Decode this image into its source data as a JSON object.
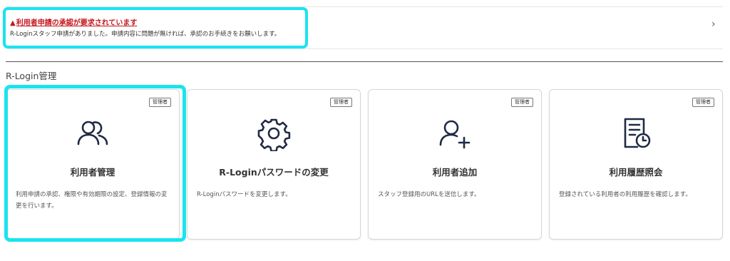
{
  "notice": {
    "warning_glyph": "▲",
    "title": "利用者申請の承認が要求されています",
    "description": "R-Loginスタッフ申請がありました。申請内容に問題が無ければ、承認のお手続きをお願いします。",
    "chevron": "›",
    "title_color": "#c4161c"
  },
  "section": {
    "title": "R-Login管理"
  },
  "cards": [
    {
      "badge": "管理者",
      "icon": "users-icon",
      "title": "利用者管理",
      "description": "利用申請の承認、権限や有効期限の設定、登録情報の変更を行います。"
    },
    {
      "badge": "管理者",
      "icon": "gear-icon",
      "title": "R-Loginパスワードの変更",
      "description": "R-Loginパスワードを変更します。"
    },
    {
      "badge": "管理者",
      "icon": "user-add-icon",
      "title": "利用者追加",
      "description": "スタッフ登録用のURLを送信します。"
    },
    {
      "badge": "管理者",
      "icon": "history-document-icon",
      "title": "利用履歴照会",
      "description": "登録されている利用者の利用履歴を確認します。"
    }
  ],
  "highlight_color": "#18e4f0",
  "icon_color": "#1f2a44"
}
